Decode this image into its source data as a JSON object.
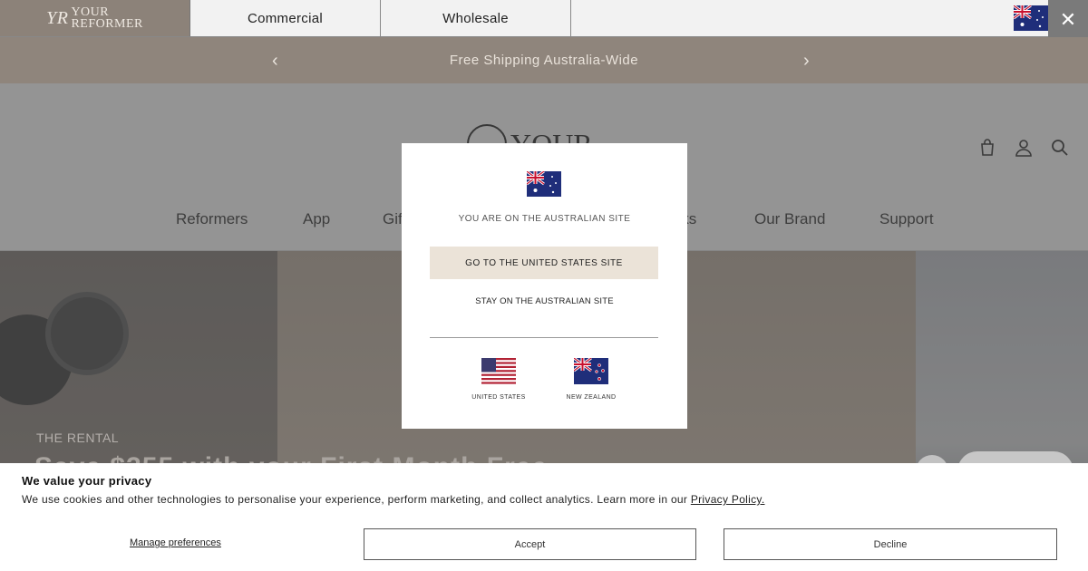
{
  "topbar": {
    "brand_line1": "YOUR",
    "brand_line2": "REFORMER",
    "tabs": [
      "Commercial",
      "Wholesale"
    ],
    "close_glyph": "✕"
  },
  "announcement": {
    "text": "Free Shipping Australia-Wide",
    "prev_glyph": "‹",
    "next_glyph": "›"
  },
  "header": {
    "logo_text": "YOUR",
    "nav": [
      {
        "label": "Reformers"
      },
      {
        "label": "App"
      },
      {
        "label": "Gifts"
      },
      {
        "label": "Socks"
      },
      {
        "label": "Our Brand"
      },
      {
        "label": "Support"
      }
    ],
    "icons": [
      "cart-icon",
      "account-icon",
      "search-icon"
    ]
  },
  "hero": {
    "eyebrow": "THE RENTAL",
    "headline": "Save $355 with your First Month Free"
  },
  "region_modal": {
    "message": "YOU ARE ON THE AUSTRALIAN SITE",
    "go_button": "GO TO THE UNITED STATES SITE",
    "stay_link": "STAY ON THE AUSTRALIAN SITE",
    "options": [
      {
        "label": "UNITED STATES",
        "flag": "us-flag"
      },
      {
        "label": "NEW ZEALAND",
        "flag": "nz-flag"
      }
    ]
  },
  "cookie_banner": {
    "title": "We value your privacy",
    "body": "We use cookies and other technologies to personalise your experience, perform marketing, and collect analytics. Learn more in our ",
    "policy_link": "Privacy Policy.",
    "manage_label": "Manage preferences",
    "accept_label": "Accept",
    "decline_label": "Decline"
  },
  "colors": {
    "announcement_bg": "#8f857c",
    "modal_button_bg": "#ebe3d8"
  }
}
